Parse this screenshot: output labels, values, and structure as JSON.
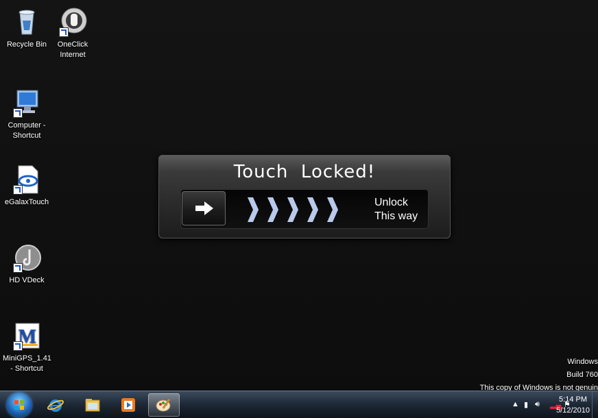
{
  "desktop_icons": [
    {
      "label": "Recycle Bin",
      "icon": "recycle-bin-icon"
    },
    {
      "label": "OneClick\nInternet",
      "icon": "oneclick-internet-icon"
    },
    {
      "label": "Computer -\nShortcut",
      "icon": "computer-icon"
    },
    {
      "label": "eGalaxTouch",
      "icon": "egalaxtouch-icon"
    },
    {
      "label": "HD VDeck",
      "icon": "hd-vdeck-icon"
    },
    {
      "label": "MiniGPS_1.41\n- Shortcut",
      "icon": "minigps-icon"
    }
  ],
  "lock_panel": {
    "title": "Touch  Locked!",
    "unlock_line1": "Unlock",
    "unlock_line2": "This way"
  },
  "watermark": {
    "line1": "Windows",
    "line2": "Build 760",
    "line3": "This copy of Windows is not genuin"
  },
  "taskbar": {
    "pinned": [
      "internet-explorer-icon",
      "windows-explorer-icon",
      "media-player-icon",
      "paint-icon"
    ],
    "clock_time": "5:14 PM",
    "clock_date": "5/12/2010"
  },
  "colors": {
    "desktop": "#111111",
    "taskbar": "#1d2835",
    "chevron": "#b9c9ec"
  }
}
